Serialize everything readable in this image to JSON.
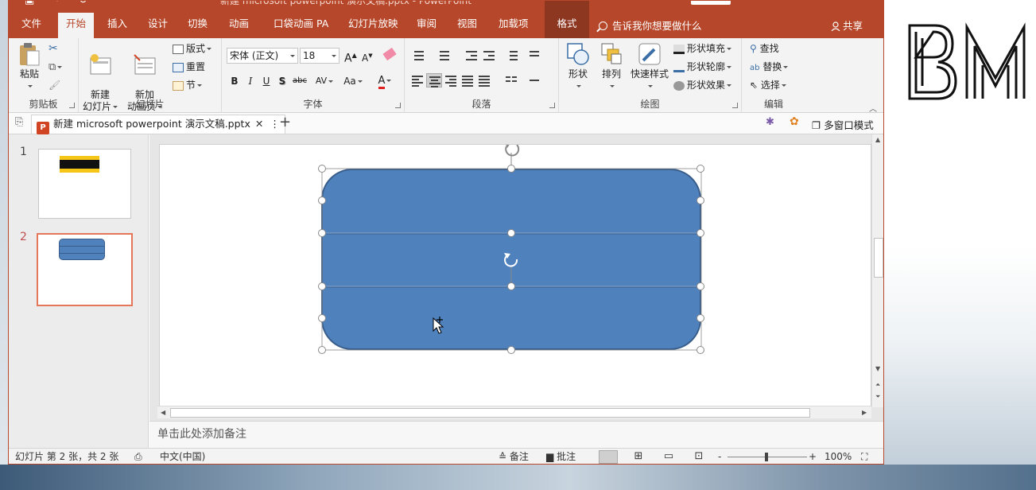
{
  "window": {
    "doc_title": "新建 microsoft powerpoint 演示文稿.pptx - PowerPoint",
    "share": "共享",
    "tell_me_placeholder": "告诉我你想要做什么"
  },
  "tabs": [
    {
      "label": "文件"
    },
    {
      "label": "开始",
      "active": true
    },
    {
      "label": "插入"
    },
    {
      "label": "设计"
    },
    {
      "label": "切换"
    },
    {
      "label": "动画"
    },
    {
      "label": "口袋动画 PA"
    },
    {
      "label": "幻灯片放映"
    },
    {
      "label": "审阅"
    },
    {
      "label": "视图"
    },
    {
      "label": "加载项"
    },
    {
      "label": "格式",
      "contextual": true
    }
  ],
  "ribbon": {
    "clipboard": {
      "label": "剪贴板",
      "paste": "粘贴"
    },
    "slides": {
      "label": "幻灯片",
      "new_slide": "新建\n幻灯片",
      "new_anim_page": "新加\n动画页",
      "layout": "版式",
      "reset": "重置",
      "section": "节"
    },
    "font": {
      "label": "字体",
      "font_name": "宋体 (正文)",
      "font_size": "18",
      "bold": "B",
      "italic": "I",
      "underline": "U",
      "shadow": "S",
      "strike": "abc",
      "spacing": "AV",
      "case": "Aa",
      "color": "A",
      "grow": "A",
      "shrink": "A"
    },
    "paragraph": {
      "label": "段落"
    },
    "drawing": {
      "label": "绘图",
      "shapes": "形状",
      "arrange": "排列",
      "quick_styles": "快速样式",
      "fill": "形状填充",
      "outline": "形状轮廓",
      "effects": "形状效果"
    },
    "editing": {
      "label": "编辑",
      "find": "查找",
      "replace": "替换",
      "select": "选择"
    }
  },
  "doc_tab": {
    "name": "新建 microsoft powerpoint 演示文稿.pptx",
    "close": "✕",
    "more": "⋮",
    "new": "+"
  },
  "doc_tools": {
    "multi_window": "多窗口模式"
  },
  "slides": [
    {
      "number": "1"
    },
    {
      "number": "2",
      "selected": true
    }
  ],
  "notes_placeholder": "单击此处添加备注",
  "status": {
    "slide_info": "幻灯片 第 2 张，共 2 张",
    "language": "中文(中国)",
    "notes": "备注",
    "comments": "批注",
    "zoom": "100%",
    "zoom_minus": "-",
    "zoom_plus": "+"
  },
  "colors": {
    "accent": "#b7472a",
    "shape_fill": "#4f81bd",
    "shape_border": "#385d8a"
  }
}
